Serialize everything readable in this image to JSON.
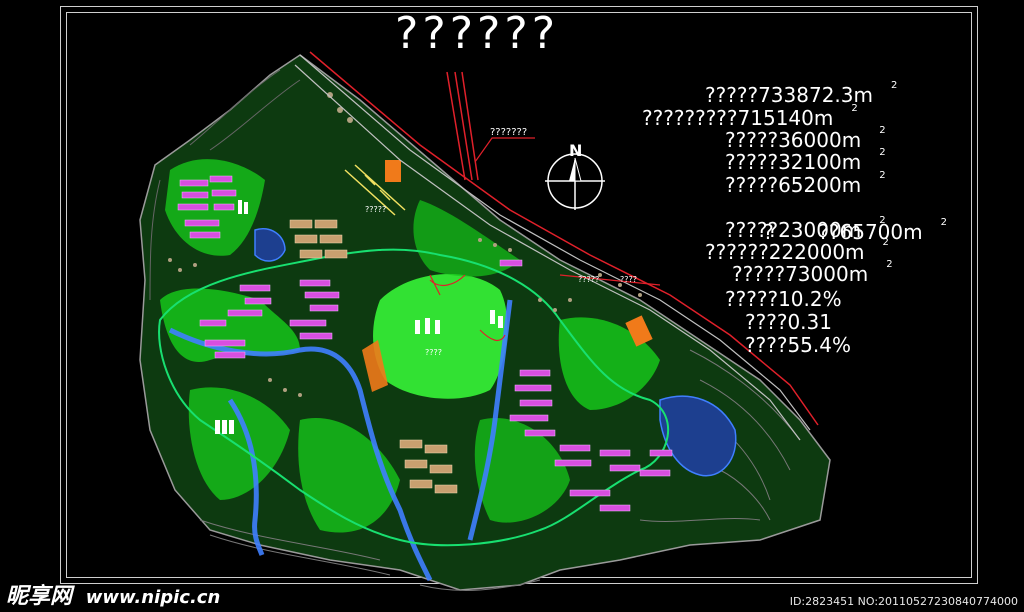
{
  "title": "??????",
  "north_label": "N",
  "road_label": "???????",
  "stats": [
    {
      "text": "?????733872.3m",
      "sup": "2"
    },
    {
      "text": "?????????715140m",
      "sup": "2"
    },
    {
      "text": "?????36000m",
      "sup": "2"
    },
    {
      "text": "?????32100m",
      "sup": "2"
    },
    {
      "text": "?????65200m",
      "sup": "2"
    },
    {
      "text": "?       ??65700m",
      "sup": "2"
    },
    {
      "text": "?????23000m",
      "sup": "2"
    },
    {
      "text": "??????222000m",
      "sup": "2"
    },
    {
      "text": "?????73000m",
      "sup": "2"
    },
    {
      "text": "?????10.2%",
      "sup": ""
    },
    {
      "text": "????0.31",
      "sup": ""
    },
    {
      "text": "????55.4%",
      "sup": ""
    }
  ],
  "map_labels": [
    "?????",
    "????",
    "?????",
    "????"
  ],
  "watermark": {
    "logo": "昵享网",
    "site": "www.nipic.cn",
    "id_text": "ID:2823451 NO:20110527230840774000"
  },
  "colors": {
    "background": "#000000",
    "frame": "#cfcfcf",
    "grass": "#16c51a",
    "park": "#39ff3a",
    "water": "#1d3f8f",
    "building": "#d74fe0",
    "road": "#c0c0c0",
    "red_line": "#e0202a",
    "orange": "#f07a1a"
  }
}
